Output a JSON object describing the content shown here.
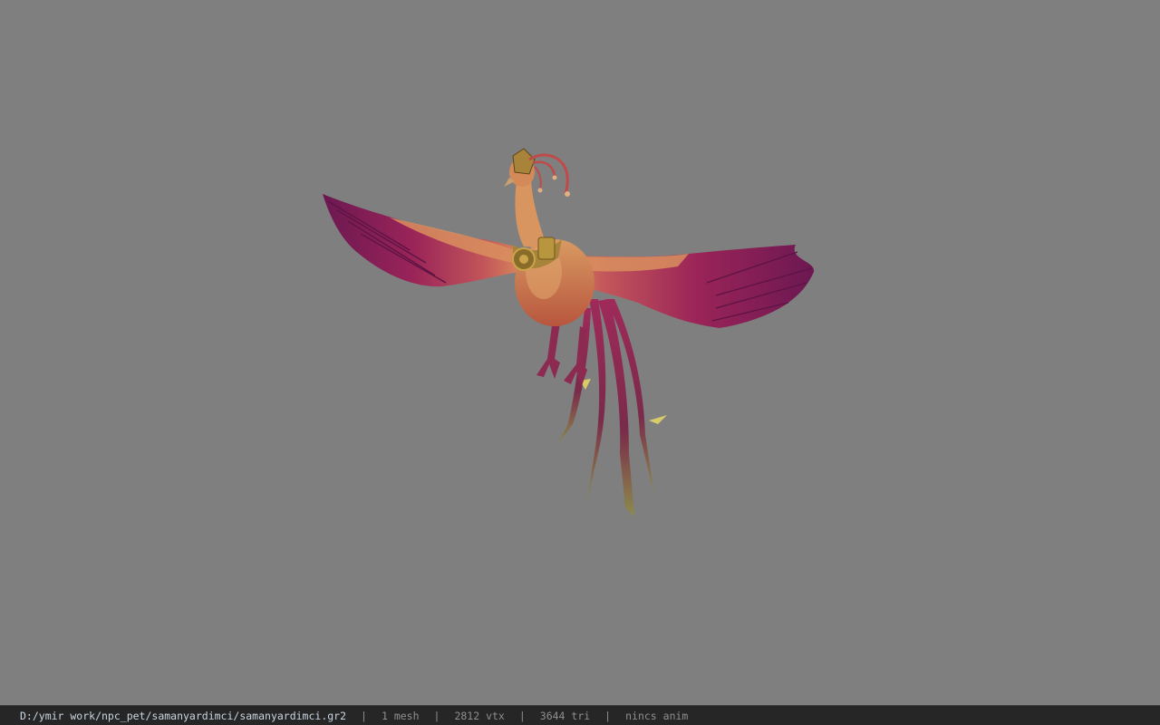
{
  "viewport": {
    "background_color": "#7f7f7f",
    "model_subject": "phoenix-bird-model"
  },
  "status_bar": {
    "file_path": "D:/ymir work/npc_pet/samanyardimci/samanyardimci.gr2",
    "separator": "|",
    "mesh_count": "1 mesh",
    "vertex_count": "2812 vtx",
    "triangle_count": "3644 tri",
    "animation_status": "nincs anim"
  },
  "colors": {
    "wing_magenta": "#8a1f5a",
    "wing_pink": "#b8325f",
    "body_orange": "#d2884f",
    "gold_ornament": "#b08a34",
    "tail_olive": "#8a8a4a",
    "status_bg": "#262626",
    "path_text": "#c9d6e2"
  }
}
